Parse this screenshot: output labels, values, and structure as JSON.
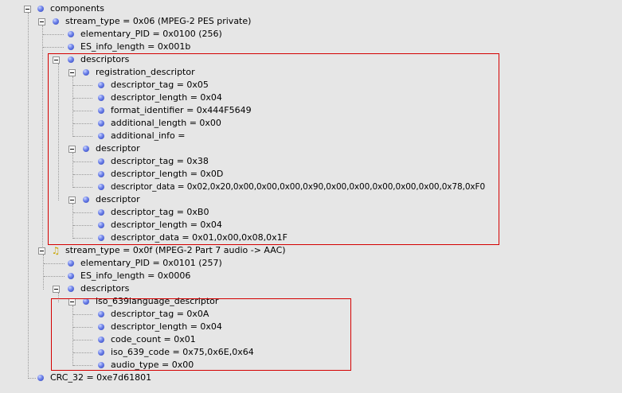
{
  "tree": {
    "root": "components",
    "stream1": {
      "label": "stream_type = 0x06 (MPEG-2 PES private)",
      "elementary_pid": "elementary_PID = 0x0100 (256)",
      "es_info_length": "ES_info_length = 0x001b",
      "descriptors": "descriptors",
      "registration": {
        "label": "registration_descriptor",
        "tag": "descriptor_tag = 0x05",
        "length": "descriptor_length = 0x04",
        "format_identifier": "format_identifier = 0x444F5649",
        "additional_length": "additional_length = 0x00",
        "additional_info": "additional_info ="
      },
      "descriptor_a": {
        "label": "descriptor",
        "tag": "descriptor_tag = 0x38",
        "length": "descriptor_length = 0x0D",
        "data": "descriptor_data = 0x02,0x20,0x00,0x00,0x00,0x90,0x00,0x00,0x00,0x00,0x00,0x78,0xF0"
      },
      "descriptor_b": {
        "label": "descriptor",
        "tag": "descriptor_tag = 0xB0",
        "length": "descriptor_length = 0x04",
        "data": "descriptor_data = 0x01,0x00,0x08,0x1F"
      }
    },
    "stream2": {
      "label": "stream_type = 0x0f (MPEG-2 Part 7 audio -> AAC)",
      "elementary_pid": "elementary_PID = 0x0101 (257)",
      "es_info_length": "ES_info_length = 0x0006",
      "descriptors": "descriptors",
      "iso639": {
        "label": "iso_639language_descriptor",
        "tag": "descriptor_tag = 0x0A",
        "length": "descriptor_length = 0x04",
        "code_count": "code_count = 0x01",
        "code": "iso_639_code = 0x75,0x6E,0x64",
        "audio_type": "audio_type = 0x00"
      }
    },
    "crc": "CRC_32 = 0xe7d61801"
  },
  "colors": {
    "background": "#e6e6e6",
    "highlight_box": "#d40000",
    "bullet": "#4a5fd6"
  },
  "icons": {
    "stream1": "blue-bullet-icon",
    "stream2": "music-note-icon"
  }
}
